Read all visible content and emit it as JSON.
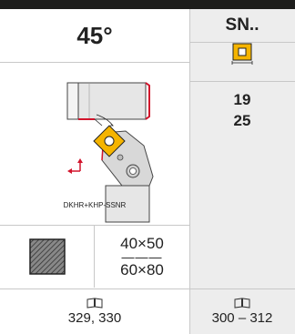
{
  "header": {
    "angle": "45°"
  },
  "insert": {
    "series": "SN..",
    "icon": "square-insert-icon",
    "sizes": [
      "19",
      "25"
    ]
  },
  "tool": {
    "designation": "DKHR+KHP-SSNR"
  },
  "shank": {
    "size_top": "40×50",
    "separator": "———",
    "size_bottom": "60×80"
  },
  "references": {
    "icon": "book-icon",
    "holder_pages": "329, 330",
    "insert_pages": "300 – 312"
  },
  "colors": {
    "header_bar": "#1d1d1b",
    "insert_fill": "#f5b400",
    "tool_accent": "#d2142c",
    "panel_grey": "#ededed"
  }
}
